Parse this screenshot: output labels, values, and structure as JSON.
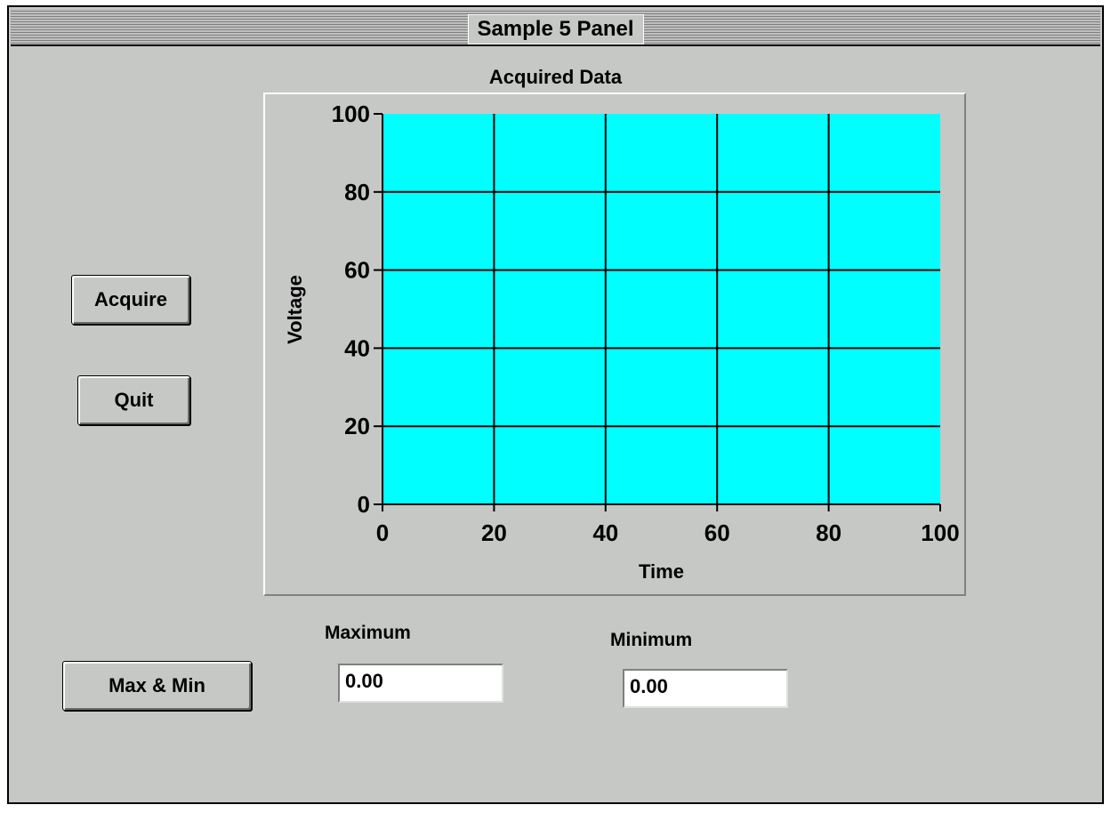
{
  "window": {
    "title": "Sample 5 Panel"
  },
  "buttons": {
    "acquire": "Acquire",
    "quit": "Quit",
    "maxmin": "Max & Min"
  },
  "fields": {
    "maximum": {
      "label": "Maximum",
      "value": "0.00"
    },
    "minimum": {
      "label": "Minimum",
      "value": "0.00"
    }
  },
  "colors": {
    "plot_bg": "#00ffff",
    "panel_bg": "#c6c8c6"
  },
  "chart_data": {
    "type": "line",
    "title": "Acquired Data",
    "xlabel": "Time",
    "ylabel": "Voltage",
    "xlim": [
      0,
      100
    ],
    "ylim": [
      0,
      100
    ],
    "xticks": [
      "0",
      "20",
      "40",
      "60",
      "80",
      "100"
    ],
    "yticks": [
      "0",
      "20",
      "40",
      "60",
      "80",
      "100"
    ],
    "grid": true,
    "series": []
  }
}
